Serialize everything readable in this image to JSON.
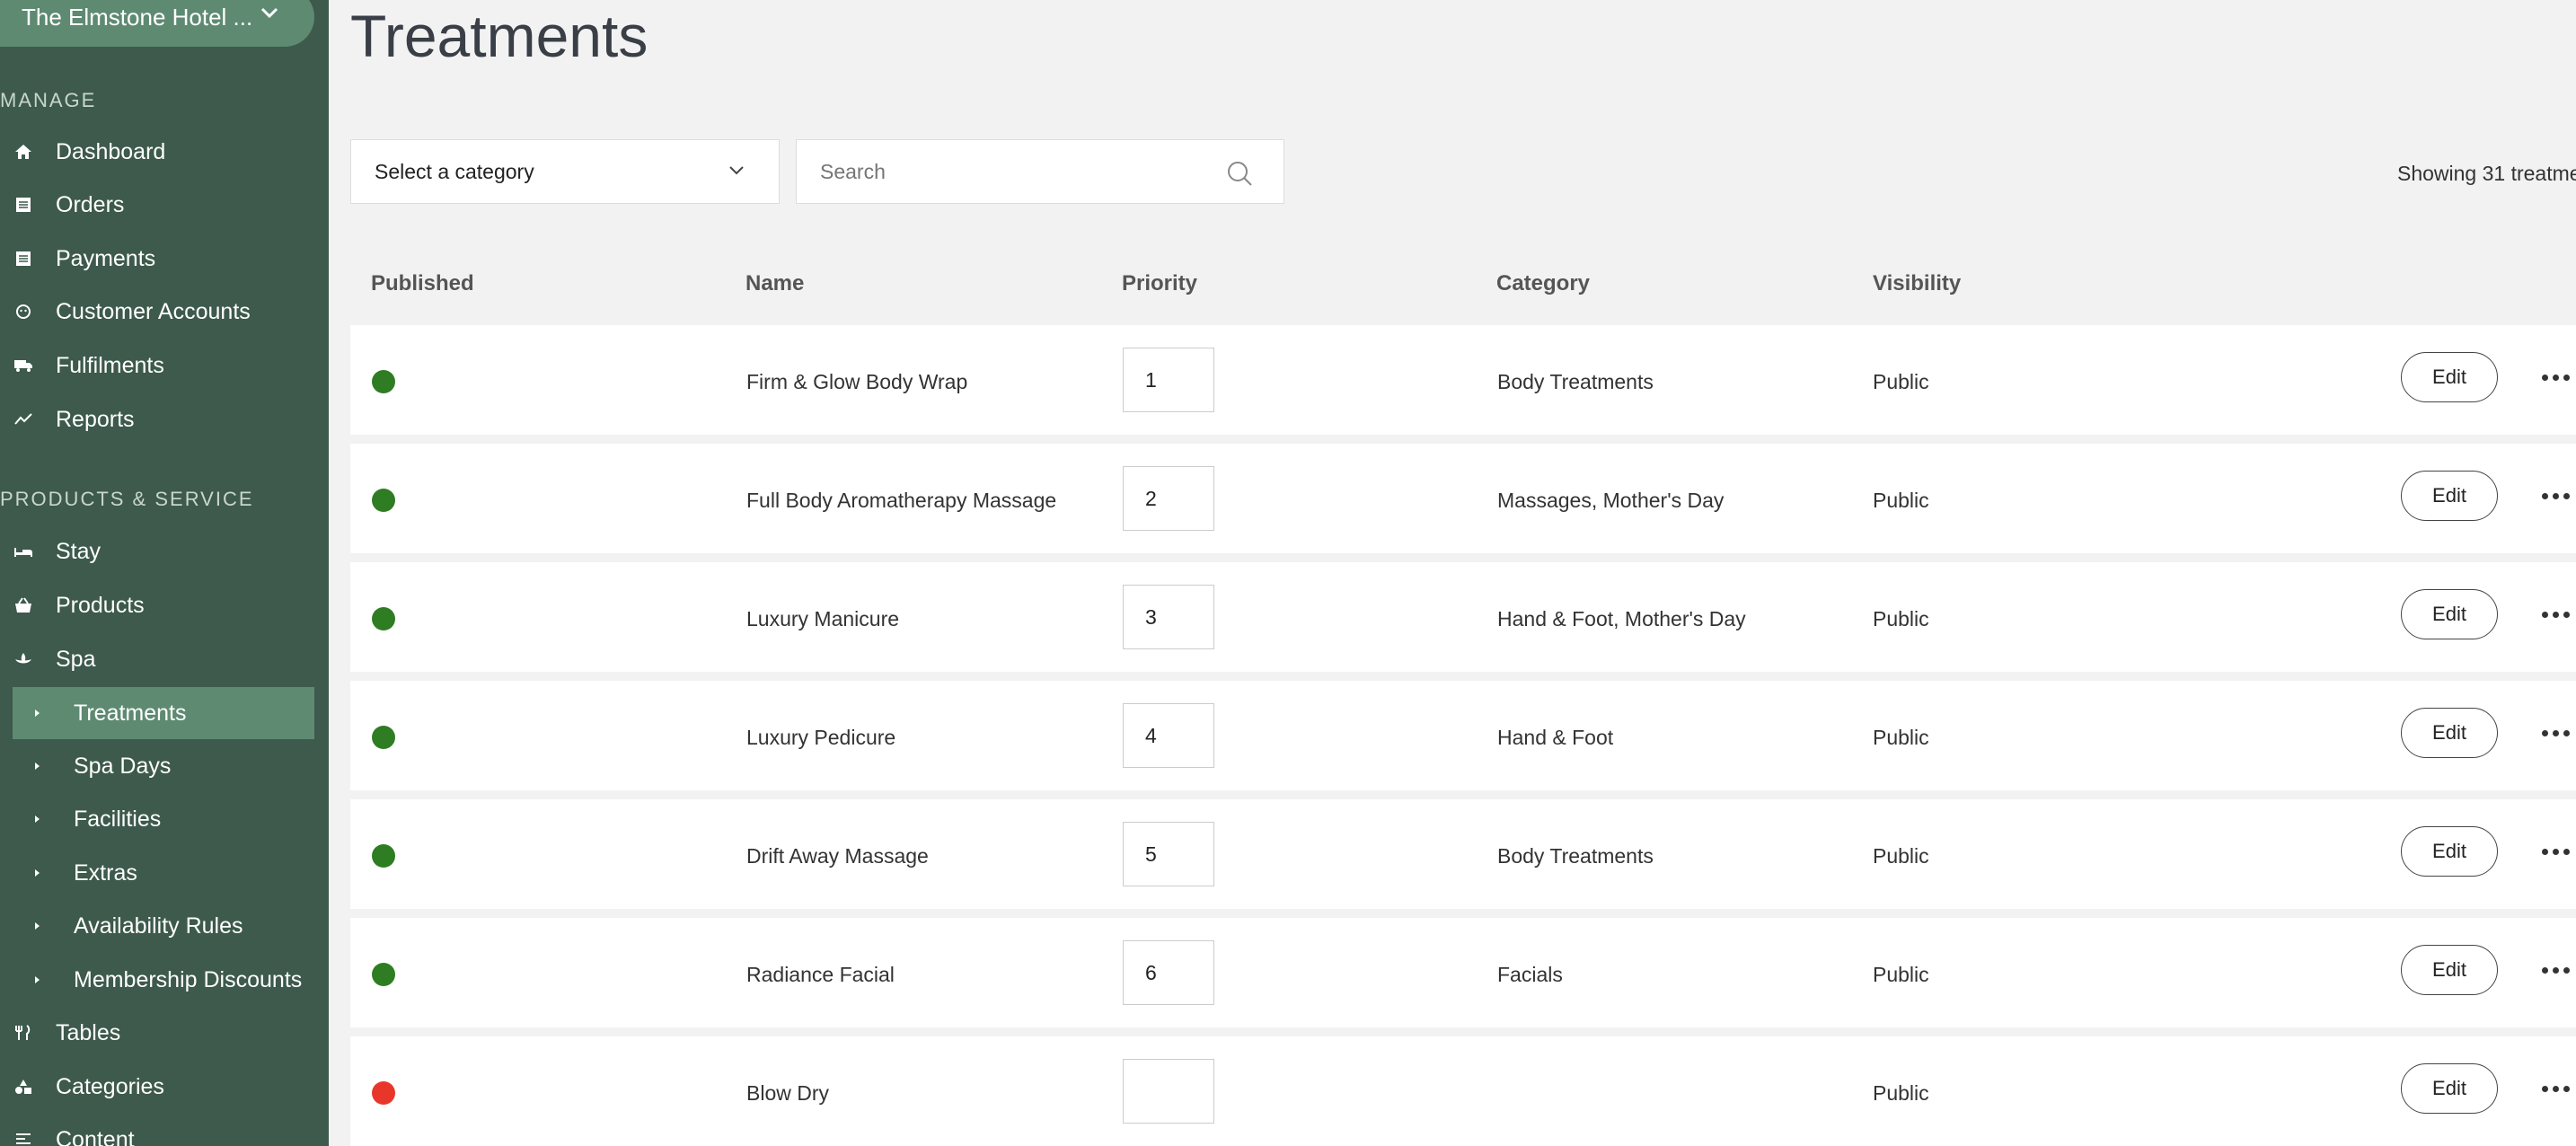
{
  "sidebar": {
    "hotel_name": "The Elmstone Hotel ...",
    "manage_label": "MANAGE",
    "manage_items": [
      {
        "label": "Dashboard",
        "icon": "home-icon"
      },
      {
        "label": "Orders",
        "icon": "list-icon"
      },
      {
        "label": "Payments",
        "icon": "list-icon"
      },
      {
        "label": "Customer Accounts",
        "icon": "face-icon"
      },
      {
        "label": "Fulfilments",
        "icon": "truck-icon"
      },
      {
        "label": "Reports",
        "icon": "trend-icon"
      }
    ],
    "products_label": "PRODUCTS & SERVICE",
    "products_items": [
      {
        "label": "Stay",
        "icon": "bed-icon"
      },
      {
        "label": "Products",
        "icon": "basket-icon"
      },
      {
        "label": "Spa",
        "icon": "spa-icon"
      }
    ],
    "spa_subitems": [
      {
        "label": "Treatments",
        "active": true
      },
      {
        "label": "Spa Days",
        "active": false
      },
      {
        "label": "Facilities",
        "active": false
      },
      {
        "label": "Extras",
        "active": false
      },
      {
        "label": "Availability Rules",
        "active": false
      },
      {
        "label": "Membership Discounts",
        "active": false
      }
    ],
    "bottom_items": [
      {
        "label": "Tables",
        "icon": "cutlery-icon"
      },
      {
        "label": "Categories",
        "icon": "shapes-icon"
      },
      {
        "label": "Content",
        "icon": "text-icon"
      }
    ]
  },
  "main": {
    "title": "Treatments",
    "category_select": "Select a category",
    "search_placeholder": "Search",
    "showing_text": "Showing 31 treatme",
    "columns": {
      "published": "Published",
      "name": "Name",
      "priority": "Priority",
      "category": "Category",
      "visibility": "Visibility"
    },
    "edit_label": "Edit",
    "colors": {
      "published": "#2e7d22",
      "unpublished": "#e8372a",
      "accent": "#5e8a72",
      "sidebar": "#3d5a4c"
    },
    "rows": [
      {
        "published": true,
        "name": "Firm & Glow Body Wrap",
        "priority": "1",
        "category": "Body Treatments",
        "visibility": "Public"
      },
      {
        "published": true,
        "name": "Full Body Aromatherapy Massage",
        "priority": "2",
        "category": "Massages, Mother's Day",
        "visibility": "Public"
      },
      {
        "published": true,
        "name": "Luxury Manicure",
        "priority": "3",
        "category": "Hand & Foot, Mother's Day",
        "visibility": "Public"
      },
      {
        "published": true,
        "name": "Luxury Pedicure",
        "priority": "4",
        "category": "Hand & Foot",
        "visibility": "Public"
      },
      {
        "published": true,
        "name": "Drift Away Massage",
        "priority": "5",
        "category": "Body Treatments",
        "visibility": "Public"
      },
      {
        "published": true,
        "name": "Radiance Facial",
        "priority": "6",
        "category": "Facials",
        "visibility": "Public"
      },
      {
        "published": false,
        "name": "Blow Dry",
        "priority": "",
        "category": "",
        "visibility": "Public"
      }
    ]
  }
}
